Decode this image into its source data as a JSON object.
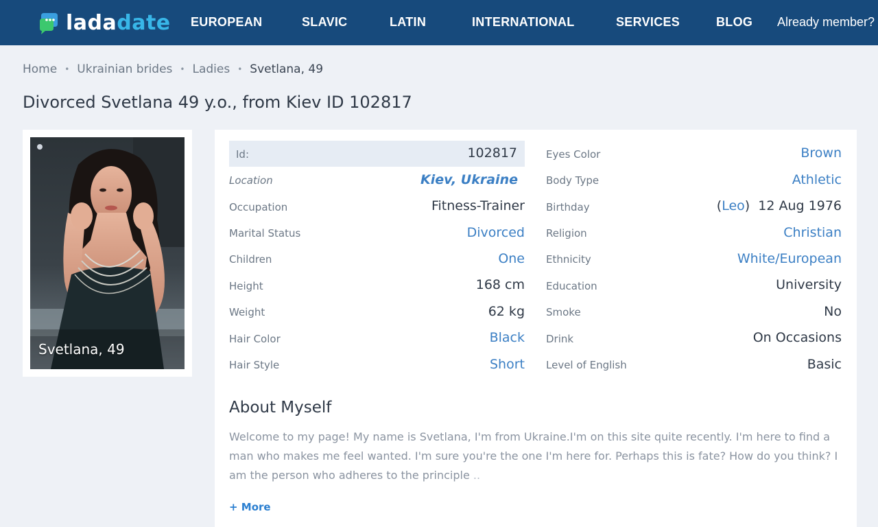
{
  "brand": {
    "name_part1": "lada",
    "name_part2": "date",
    "accent_color": "#38b6e8",
    "header_color": "#174a7c"
  },
  "nav": {
    "items": [
      "EUROPEAN",
      "SLAVIC",
      "LATIN",
      "INTERNATIONAL",
      "SERVICES",
      "BLOG"
    ],
    "member_link": "Already member?"
  },
  "breadcrumb": {
    "items": [
      "Home",
      "Ukrainian brides",
      "Ladies"
    ],
    "current": "Svetlana, 49",
    "separator": "•"
  },
  "page_title": "Divorced Svetlana 49 y.o., from Kiev ID 102817",
  "photo": {
    "caption": "Svetlana, 49",
    "icon": "woman-portrait"
  },
  "left_fields": [
    {
      "label": "Id:",
      "value": "102817"
    },
    {
      "label": "Location",
      "value": "Kiev, Ukraine"
    },
    {
      "label": "Occupation",
      "value": "Fitness-Trainer"
    },
    {
      "label": "Marital Status",
      "value": "Divorced"
    },
    {
      "label": "Children",
      "value": "One"
    },
    {
      "label": "Height",
      "value": "168 cm"
    },
    {
      "label": "Weight",
      "value": "62 kg"
    },
    {
      "label": "Hair Color",
      "value": "Black"
    },
    {
      "label": "Hair Style",
      "value": "Short"
    }
  ],
  "right_fields": [
    {
      "label": "Eyes Color",
      "value": "Brown"
    },
    {
      "label": "Body Type",
      "value": "Athletic"
    },
    {
      "label": "Birthday",
      "zodiac": "Leo",
      "value": "12 Aug 1976"
    },
    {
      "label": "Religion",
      "value": "Christian"
    },
    {
      "label": "Ethnicity",
      "value": "White/European"
    },
    {
      "label": "Education",
      "value": "University"
    },
    {
      "label": "Smoke",
      "value": "No"
    },
    {
      "label": "Drink",
      "value": "On Occasions"
    },
    {
      "label": "Level of English",
      "value": "Basic"
    }
  ],
  "about": {
    "title": "About Myself",
    "text": "Welcome to my page! My name is Svetlana, I'm from Ukraine.I'm on this site quite recently. I'm here to find a man who makes me feel wanted. I'm sure you're the one I'm here for. Perhaps this is fate? How do you think? I am the person who adheres to the principle",
    "ellipsis": "..",
    "more": "+ More"
  }
}
